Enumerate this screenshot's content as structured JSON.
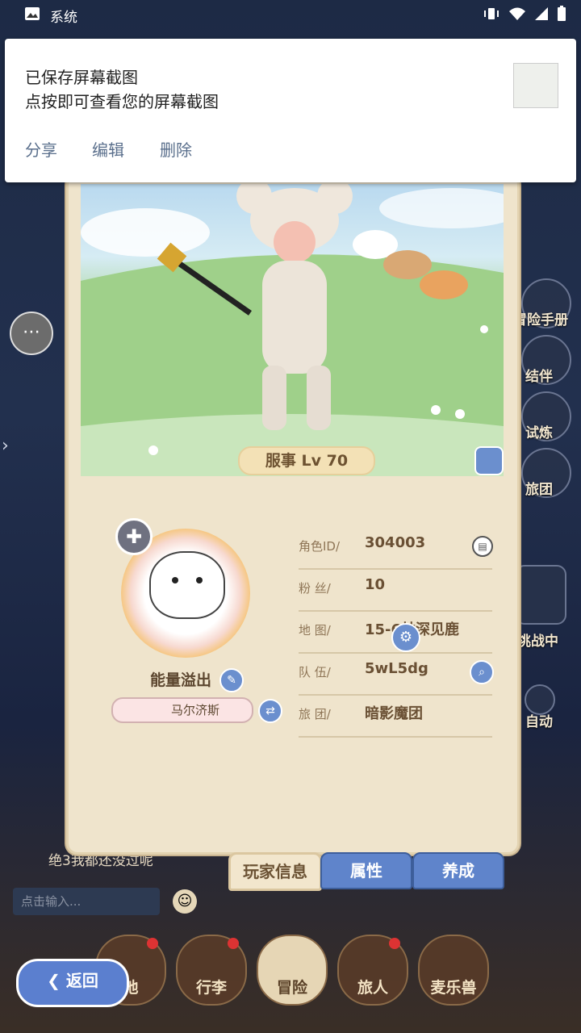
{
  "status_bar": {
    "label": "系统"
  },
  "notification": {
    "line1": "已保存屏幕截图",
    "line2": "点按即可查看您的屏幕截图",
    "actions": [
      "分享",
      "编辑",
      "删除"
    ]
  },
  "side_menu": {
    "items": [
      "冒险手册",
      "结伴",
      "试炼",
      "旅团",
      "挑战中",
      "自动"
    ]
  },
  "card": {
    "level_label": "服事 Lv 70",
    "username": "能量溢出",
    "title_name": "马尔济斯",
    "fields": [
      {
        "key": "角色ID/",
        "value": "304003"
      },
      {
        "key": "粉  丝/",
        "value": "10"
      },
      {
        "key": "地  图/",
        "value": "15-6林深见鹿"
      },
      {
        "key": "队  伍/",
        "value": "5wL5dg"
      },
      {
        "key": "旅  团/",
        "value": "暗影魔团"
      }
    ]
  },
  "tabs": [
    "玩家信息",
    "属性",
    "养成"
  ],
  "chat": {
    "message": "绝3我都还没过呢",
    "input_placeholder": "点击输入..."
  },
  "bottom_nav": [
    "地",
    "行李",
    "冒险",
    "旅人",
    "麦乐兽"
  ],
  "back_label": "返回",
  "colors": {
    "accent": "#5f84cb",
    "panel": "#efe4cc",
    "text_brown": "#6a5034"
  }
}
